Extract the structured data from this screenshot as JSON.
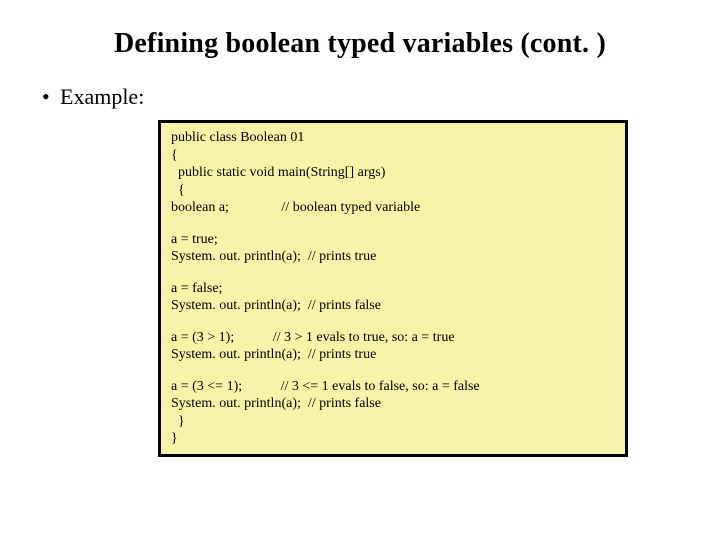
{
  "title": "Defining boolean typed variables (cont. )",
  "bullet": {
    "dot": "•",
    "text": "Example:"
  },
  "code": {
    "l1": "public class Boolean 01",
    "l2": "{",
    "l3": "  public static void main(String[] args)",
    "l4": "  {",
    "l5": "boolean a;               // boolean typed variable",
    "l6": "a = true;",
    "l7": "System. out. println(a);  // prints true",
    "l8": "a = false;",
    "l9": "System. out. println(a);  // prints false",
    "l10": "a = (3 > 1);           // 3 > 1 evals to true, so: a = true",
    "l11": "System. out. println(a);  // prints true",
    "l12": "a = (3 <= 1);           // 3 <= 1 evals to false, so: a = false",
    "l13": "System. out. println(a);  // prints false",
    "l14": "  }",
    "l15": "}"
  }
}
